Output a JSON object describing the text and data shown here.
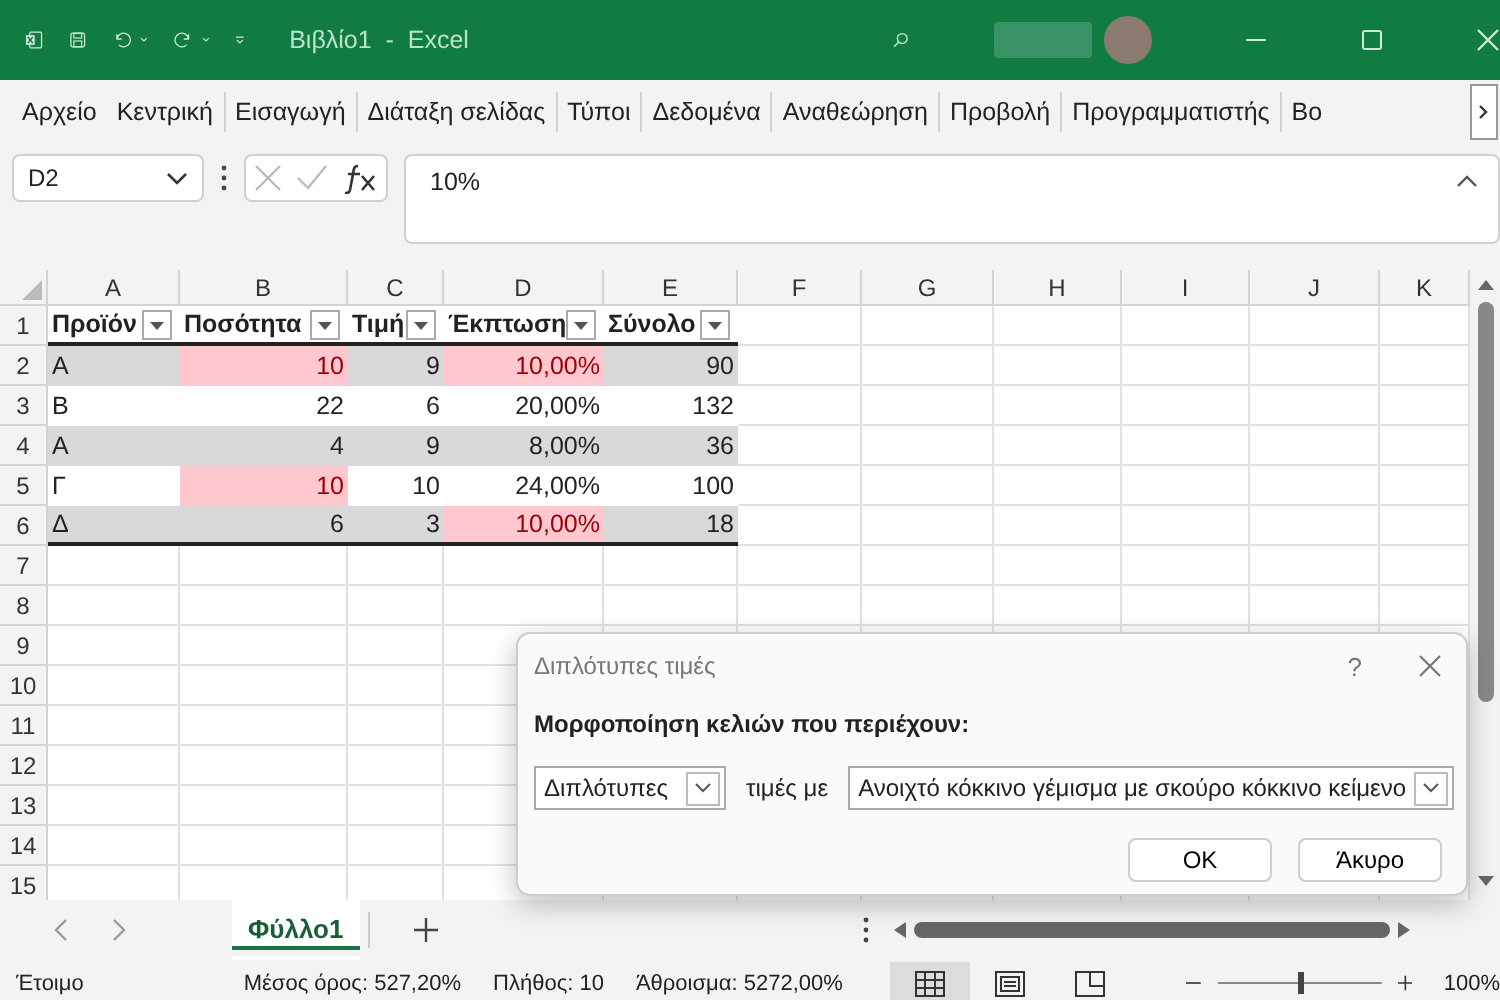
{
  "title_bar": {
    "title": "Βιβλίο1  -  Excel"
  },
  "ribbon_tabs": [
    {
      "label": "Αρχείο"
    },
    {
      "label": "Κεντρική"
    },
    {
      "label": "Εισαγωγή"
    },
    {
      "label": "Διάταξη σελίδας"
    },
    {
      "label": "Τύποι"
    },
    {
      "label": "Δεδομένα"
    },
    {
      "label": "Αναθεώρηση"
    },
    {
      "label": "Προβολή"
    },
    {
      "label": "Προγραμματιστής"
    },
    {
      "label": "Βο"
    }
  ],
  "formula_bar": {
    "name_box": "D2",
    "formula": "10%"
  },
  "sheet": {
    "columns": [
      "A",
      "B",
      "C",
      "D",
      "E",
      "F",
      "G",
      "H",
      "I",
      "J",
      "K"
    ],
    "header_row": {
      "number": "1",
      "cells": [
        "Προϊόν",
        "Ποσότητα",
        "Τιμή",
        "Έκπτωση",
        "Σύνολο"
      ]
    },
    "rows": [
      {
        "number": "2",
        "banded": true,
        "cells": [
          {
            "text": "Α",
            "highlight": false
          },
          {
            "text": "10",
            "highlight": true
          },
          {
            "text": "9",
            "highlight": false
          },
          {
            "text": "10,00%",
            "highlight": true
          },
          {
            "text": "90",
            "highlight": false
          }
        ]
      },
      {
        "number": "3",
        "banded": false,
        "cells": [
          {
            "text": "Β",
            "highlight": false
          },
          {
            "text": "22",
            "highlight": false
          },
          {
            "text": "6",
            "highlight": false
          },
          {
            "text": "20,00%",
            "highlight": false
          },
          {
            "text": "132",
            "highlight": false
          }
        ]
      },
      {
        "number": "4",
        "banded": true,
        "cells": [
          {
            "text": "Α",
            "highlight": false
          },
          {
            "text": "4",
            "highlight": false
          },
          {
            "text": "9",
            "highlight": false
          },
          {
            "text": "8,00%",
            "highlight": false
          },
          {
            "text": "36",
            "highlight": false
          }
        ]
      },
      {
        "number": "5",
        "banded": false,
        "cells": [
          {
            "text": "Γ",
            "highlight": false
          },
          {
            "text": "10",
            "highlight": true
          },
          {
            "text": "10",
            "highlight": false
          },
          {
            "text": "24,00%",
            "highlight": false
          },
          {
            "text": "100",
            "highlight": false
          }
        ]
      },
      {
        "number": "6",
        "banded": true,
        "cells": [
          {
            "text": "Δ",
            "highlight": false
          },
          {
            "text": "6",
            "highlight": false
          },
          {
            "text": "3",
            "highlight": false
          },
          {
            "text": "10,00%",
            "highlight": true
          },
          {
            "text": "18",
            "highlight": false
          }
        ]
      }
    ],
    "empty_rows": [
      "7",
      "8",
      "9",
      "10",
      "11",
      "12",
      "13",
      "14",
      "15"
    ]
  },
  "dialog": {
    "title": "Διπλότυπες τιμές",
    "help": "?",
    "heading": "Μορφοποίηση κελιών που περιέχουν:",
    "rule_dropdown": "Διπλότυπες",
    "connector": "τιμές με",
    "format_dropdown": "Ανοιχτό κόκκινο γέμισμα με σκούρο κόκκινο κείμενο",
    "buttons": [
      "OK",
      "Άκυρο"
    ]
  },
  "sheet_tabs": [
    {
      "label": "Φύλλο1",
      "selected": true
    }
  ],
  "status_bar": {
    "ready": "Έτοιμο",
    "stats": [
      "Μέσος όρος: 527,20%",
      "Πλήθος: 10",
      "Άθροισμα: 5272,00%"
    ],
    "views": [
      {
        "kind": "normal",
        "selected": true
      },
      {
        "kind": "page-layout",
        "selected": false
      },
      {
        "kind": "page-break",
        "selected": false
      }
    ],
    "zoom_slider": {
      "level": 0.5
    },
    "zoom": "100%"
  }
}
